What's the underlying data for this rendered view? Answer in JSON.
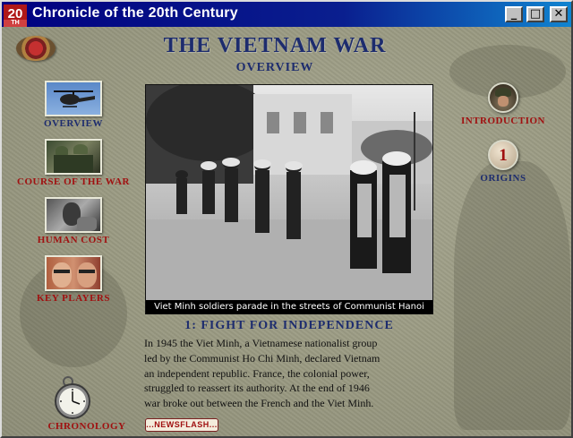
{
  "window": {
    "app_icon_text": "20",
    "app_icon_sub": "TH",
    "title": "Chronicle of the 20th Century",
    "minimize_glyph": "_",
    "maximize_glyph": "□",
    "close_glyph": "✕"
  },
  "header": {
    "title": "THE VIETNAM WAR",
    "subtitle": "OVERVIEW"
  },
  "left_nav": [
    {
      "label": "OVERVIEW",
      "icon": "helicopter-icon",
      "active": true
    },
    {
      "label": "COURSE OF THE WAR",
      "icon": "soldiers-thumbnail",
      "active": false
    },
    {
      "label": "HUMAN COST",
      "icon": "portrait-thumbnail",
      "active": false
    },
    {
      "label": "KEY PLAYERS",
      "icon": "leaders-thumbnail",
      "active": false
    }
  ],
  "right_nav": {
    "introduction": {
      "label": "INTRODUCTION",
      "icon": "soldier-helmet-icon"
    },
    "origins": {
      "label": "ORIGINS",
      "number": "1"
    }
  },
  "photo": {
    "caption": "Viet Minh soldiers parade in the streets of Communist Hanoi"
  },
  "section": {
    "heading": "1: FIGHT FOR INDEPENDENCE",
    "lines": [
      "In 1945 the Viet Minh, a Vietnamese nationalist group",
      "led by the Communist Ho Chi Minh, declared Vietnam",
      "an independent republic. France, the colonial power,",
      "struggled to reassert its authority. At the end of 1946",
      "war broke out between the French and the Viet Minh."
    ]
  },
  "newsflash_label": "...NEWSFLASH...",
  "chronology_label": "CHRONOLOGY",
  "colors": {
    "title_blue": "#1d2c6e",
    "label_red": "#a01010",
    "titlebar": "#000080",
    "background": "#9a9a82"
  }
}
